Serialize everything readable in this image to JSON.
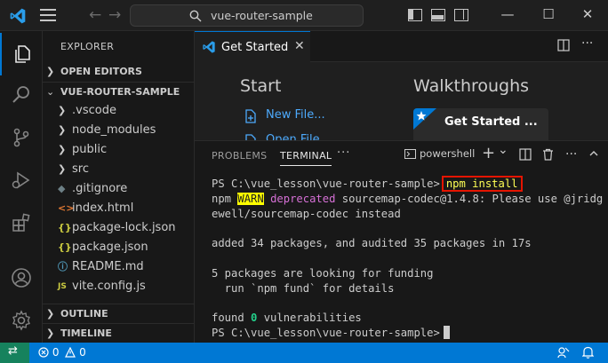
{
  "titlebar": {
    "back_glyph": "←",
    "forward_glyph": "→",
    "search_text": "vue-router-sample",
    "minimize_glyph": "—",
    "maximize_glyph": "☐",
    "close_glyph": "✕"
  },
  "activity_icons": [
    "explorer-icon",
    "search-icon",
    "source-control-icon",
    "run-debug-icon",
    "extensions-icon",
    "account-icon",
    "settings-gear-icon"
  ],
  "sidebar": {
    "title": "EXPLORER",
    "sections": {
      "open_editors": "OPEN EDITORS",
      "project": "VUE-ROUTER-SAMPLE",
      "outline": "OUTLINE",
      "timeline": "TIMELINE"
    },
    "chevron_right": "❯",
    "chevron_down": "⌄",
    "items": [
      {
        "name": ".vscode",
        "icon": "",
        "color": "#cccccc"
      },
      {
        "name": "node_modules",
        "icon": "",
        "color": "#cccccc"
      },
      {
        "name": "public",
        "icon": "",
        "color": "#cccccc"
      },
      {
        "name": "src",
        "icon": "",
        "color": "#cccccc"
      },
      {
        "name": ".gitignore",
        "icon": "◆",
        "color": "#6d8086"
      },
      {
        "name": "index.html",
        "icon": "<>",
        "color": "#e37933"
      },
      {
        "name": "package-lock.json",
        "icon": "{}",
        "color": "#cbcb41"
      },
      {
        "name": "package.json",
        "icon": "{}",
        "color": "#cbcb41"
      },
      {
        "name": "README.md",
        "icon": "ⓘ",
        "color": "#519aba"
      },
      {
        "name": "vite.config.js",
        "icon": "JS",
        "color": "#cbcb41"
      }
    ]
  },
  "editor": {
    "tab_label": "Get Started",
    "tab_close": "✕",
    "start_title": "Start",
    "walkthroughs_title": "Walkthroughs",
    "start_links": [
      "New File...",
      "Open File..."
    ],
    "walk_card_title": "Get Started ..."
  },
  "panel": {
    "tabs": [
      "PROBLEMS",
      "TERMINAL"
    ],
    "more": "···",
    "shell_name": "powershell",
    "add_glyph": "+",
    "dropdown_glyph": "⌄",
    "ellipsis": "···",
    "maximize_glyph": "⌃",
    "close_glyph": "✕"
  },
  "terminal": {
    "prompt": "PS C:\\vue_lesson\\vue-router-sample>",
    "command": "npm install",
    "warn_prefix": "npm ",
    "warn_label": "WARN",
    "deprecated_label": "deprecated",
    "warn_rest": " sourcemap-codec@1.4.8: Please use @jridg",
    "warn_line2": "ewell/sourcemap-codec instead",
    "added_line": "added 34 packages, and audited 35 packages in 17s",
    "funding_line1": "5 packages are looking for funding",
    "funding_line2": "  run `npm fund` for details",
    "found_prefix": "found ",
    "found_zero": "0",
    "found_suffix": " vulnerabilities",
    "prompt2": "PS C:\\vue_lesson\\vue-router-sample>"
  },
  "statusbar": {
    "remote_glyph": "⇄",
    "errors_count": "0",
    "warnings_count": "0"
  },
  "colors": {
    "accent": "#0078d4",
    "remote": "#16825d",
    "highlight_border": "#e51400"
  }
}
